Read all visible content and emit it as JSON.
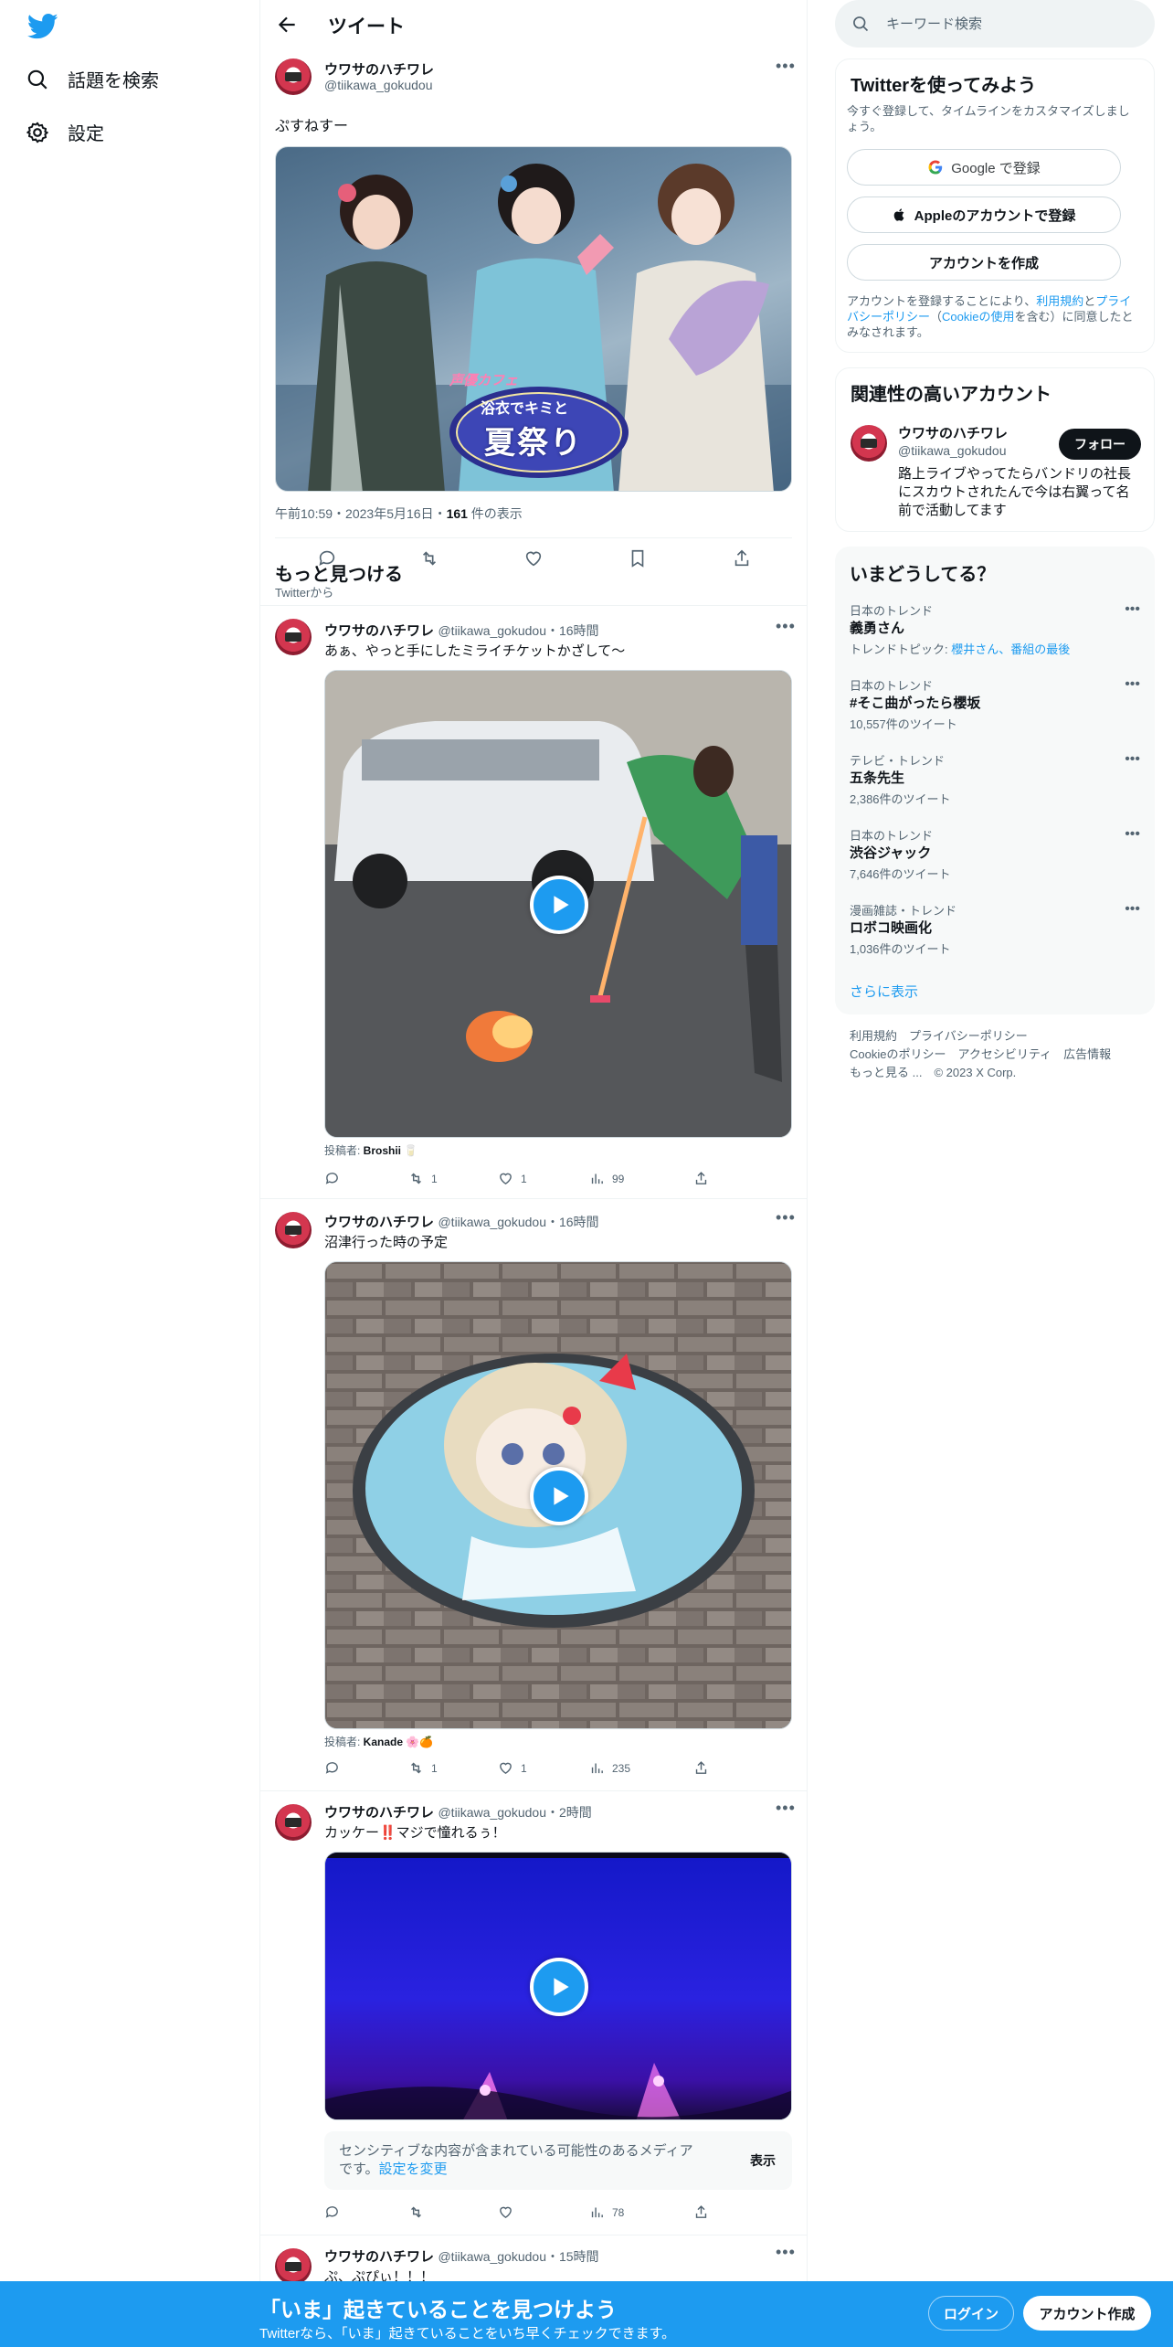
{
  "nav": {
    "explore_label": "話題を検索",
    "settings_label": "設定"
  },
  "header": {
    "title": "ツイート"
  },
  "main_tweet": {
    "name": "ウワサのハチワレ",
    "handle": "@tiikawa_gokudou",
    "text": "ぷすねすー",
    "image_text_1": "声優カフェ",
    "image_text_2": "浴衣でキミと",
    "image_text_3": "夏祭り",
    "time": "午前10:59",
    "date": "2023年5月16日",
    "views_count": "161",
    "views_label": " 件の表示"
  },
  "discover": {
    "title": "もっと見つける",
    "source": "Twitterから"
  },
  "tweets": [
    {
      "name": "ウワサのハチワレ",
      "handle": "@tiikawa_gokudou",
      "sep": "・",
      "time": "16時間",
      "text": "あぁ、やっと手にしたミライチケットかざして〜",
      "attribution_label": "投稿者: ",
      "attribution_name": "Broshii 🥛",
      "replies": "",
      "retweets": "1",
      "likes": "1",
      "views": "99"
    },
    {
      "name": "ウワサのハチワレ",
      "handle": "@tiikawa_gokudou",
      "sep": "・",
      "time": "16時間",
      "text": "沼津行った時の予定",
      "attribution_label": "投稿者: ",
      "attribution_name": "Kanade 🌸🍊",
      "replies": "",
      "retweets": "1",
      "likes": "1",
      "views": "235"
    },
    {
      "name": "ウワサのハチワレ",
      "handle": "@tiikawa_gokudou",
      "sep": "・",
      "time": "2時間",
      "text": "カッケー‼️マジで憧れるぅ！",
      "sensitive_notice": "センシティブな内容が含まれている可能性のあるメディアです。",
      "sensitive_link": "設定を変更",
      "show_label": "表示",
      "views": "78"
    },
    {
      "name": "ウワサのハチワレ",
      "handle": "@tiikawa_gokudou",
      "sep": "・",
      "time": "15時間",
      "text": "ぷ、ぷぴぃ！！！"
    }
  ],
  "search": {
    "placeholder": "キーワード検索"
  },
  "signup_card": {
    "title": "Twitterを使ってみよう",
    "subtitle": "今すぐ登録して、タイムラインをカスタマイズしましょう。",
    "google_label": "Google で登録",
    "apple_label": "Appleのアカウントで登録",
    "create_label": "アカウントを作成",
    "legal_1": "アカウントを登録することにより、",
    "legal_terms": "利用規約",
    "legal_2": "と",
    "legal_privacy": "プライバシーポリシー",
    "legal_3": "（",
    "legal_cookie": "Cookieの使用",
    "legal_4": "を含む）に同意したとみなされます。"
  },
  "related_card": {
    "title": "関連性の高いアカウント",
    "name": "ウワサのハチワレ",
    "handle": "@tiikawa_gokudou",
    "follow_label": "フォロー",
    "bio": "路上ライブやってたらバンドリの社長にスカウトされたんで今は右翼って名前で活動してます"
  },
  "trends_card": {
    "title": "いまどうしてる？",
    "items": [
      {
        "meta": "日本のトレンド",
        "name": "義勇さん",
        "sub_label": "トレンドトピック: ",
        "sub_link": "櫻井さん、番組の最後"
      },
      {
        "meta": "日本のトレンド",
        "name": "#そこ曲がったら櫻坂",
        "sub": "10,557件のツイート"
      },
      {
        "meta": "テレビ・トレンド",
        "name": "五条先生",
        "sub": "2,386件のツイート"
      },
      {
        "meta": "日本のトレンド",
        "name": "渋谷ジャック",
        "sub": "7,646件のツイート"
      },
      {
        "meta": "漫画雑誌・トレンド",
        "name": "ロボコ映画化",
        "sub": "1,036件のツイート"
      }
    ],
    "more_label": "さらに表示"
  },
  "footer": {
    "terms": "利用規約",
    "privacy": "プライバシーポリシー",
    "cookie": "Cookieのポリシー",
    "accessibility": "アクセシビリティ",
    "ads": "広告情報",
    "more": "もっと見る ...",
    "copyright": "© 2023 X Corp."
  },
  "bottom_bar": {
    "title": "「いま」起きていることを見つけよう",
    "subtitle": "Twitterなら、「いま」起きていることをいち早くチェックできます。",
    "login_label": "ログイン",
    "signup_label": "アカウント作成"
  },
  "colors": {
    "accent": "#1d9bf0",
    "text": "#0f1419",
    "muted": "#536471",
    "border": "#eff3f4"
  }
}
